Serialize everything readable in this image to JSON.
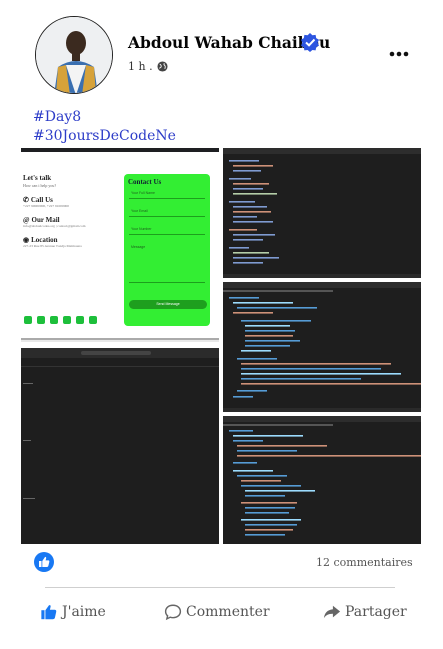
{
  "post": {
    "author": "Abdoul Wahab Chaibou",
    "time": "1 h .",
    "hashtags": [
      "#Day8",
      "#30JoursDeCodeNe"
    ]
  },
  "contact_preview": {
    "title": "Let's talk",
    "subtitle": "How can i help you?",
    "call_label": "Call Us",
    "call_text": "+227 90000000, +227 91000000",
    "mail_label": "Our Mail",
    "mail_text": "info@abdoulcodes.org | contact@gmail.com",
    "location_label": "Location",
    "location_text": "227-23 Rue 85 Avenue Tondja Maimouna",
    "form_title": "Contact Us",
    "placeholders": [
      "Your Full Name",
      "Your Email",
      "Your Number",
      "Message"
    ],
    "send_label": "Send Message"
  },
  "summary": {
    "comments": "12 commentaires"
  },
  "actions": {
    "like": "J'aime",
    "comment": "Commenter",
    "share": "Partager"
  },
  "colors": {
    "brand": "#1878f3",
    "hashtag": "#2d3cc8",
    "form_green": "#33ee33",
    "editor_bg": "#1e1e1e"
  }
}
